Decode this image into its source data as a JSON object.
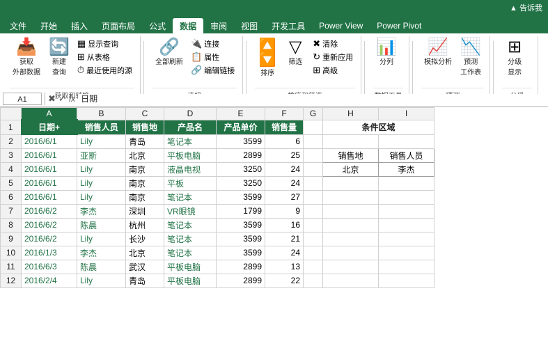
{
  "tabs": [
    "文件",
    "开始",
    "插入",
    "页面布局",
    "公式",
    "数据",
    "审阅",
    "视图",
    "开发工具",
    "Power View",
    "Power Pivot"
  ],
  "active_tab": "数据",
  "alert": "告诉我",
  "ribbon": {
    "groups": [
      {
        "label": "获取和转换",
        "buttons": [
          {
            "icon": "📥",
            "label": "获取\n外部数据"
          },
          {
            "icon": "🔄",
            "label": "新建\n查询"
          },
          {
            "small": [
              "显示查询",
              "从表格",
              "最近使用的源"
            ]
          }
        ]
      },
      {
        "label": "连接",
        "buttons": [
          {
            "icon": "🔗",
            "label": "全部刷新"
          },
          {
            "small": [
              "连接",
              "属性",
              "编辑链接"
            ]
          }
        ]
      },
      {
        "label": "排序和筛选",
        "buttons": [
          {
            "icon": "AZ↑",
            "label": "排序"
          },
          {
            "icon": "▽",
            "label": "筛选"
          },
          {
            "small": [
              "清除",
              "重新应用",
              "高级"
            ]
          }
        ]
      },
      {
        "label": "数据工具",
        "buttons": [
          {
            "icon": "📊",
            "label": "分列"
          }
        ]
      },
      {
        "label": "预测",
        "buttons": [
          {
            "icon": "📈",
            "label": "模拟分析"
          },
          {
            "icon": "📉",
            "label": "预测\n工作表"
          }
        ]
      },
      {
        "label": "分级",
        "buttons": [
          {
            "icon": "⊞",
            "label": "分级\n显示"
          }
        ]
      }
    ]
  },
  "formula_bar": {
    "cell_ref": "A1",
    "formula": "日期"
  },
  "columns": [
    "A",
    "B",
    "C",
    "D",
    "E",
    "F",
    "G",
    "H",
    "I"
  ],
  "col_headers": [
    "日期+",
    "销售人员",
    "销售地",
    "产品名",
    "产品单价",
    "销售量",
    "",
    "条件区域",
    ""
  ],
  "rows": [
    [
      "",
      "",
      "",
      "",
      "",
      "",
      "",
      "",
      ""
    ],
    [
      "2016/6/1",
      "Lily",
      "青岛",
      "笔记本",
      "3599",
      "6",
      "",
      "",
      ""
    ],
    [
      "2016/6/1",
      "亚斯",
      "北京",
      "平板电脑",
      "2899",
      "25",
      "",
      "",
      ""
    ],
    [
      "2016/6/1",
      "Lily",
      "南京",
      "液晶电视",
      "3250",
      "24",
      "",
      "",
      ""
    ],
    [
      "2016/6/1",
      "Lily",
      "南京",
      "平板",
      "3250",
      "24",
      "",
      "",
      ""
    ],
    [
      "2016/6/1",
      "Lily",
      "南京",
      "笔记本",
      "3599",
      "27",
      "",
      "",
      ""
    ],
    [
      "2016/6/2",
      "李杰",
      "深圳",
      "VR眼镜",
      "1799",
      "9",
      "",
      "",
      ""
    ],
    [
      "2016/6/2",
      "陈晨",
      "杭州",
      "笔记本",
      "3599",
      "16",
      "",
      "",
      ""
    ],
    [
      "2016/6/2",
      "Lily",
      "长沙",
      "笔记本",
      "3599",
      "21",
      "",
      "",
      ""
    ],
    [
      "2016/1/3",
      "李杰",
      "北京",
      "笔记本",
      "3599",
      "24",
      "",
      "",
      ""
    ],
    [
      "2016/6/3",
      "陈晨",
      "武汉",
      "平板电脑",
      "2899",
      "13",
      "",
      "",
      ""
    ],
    [
      "2016/2/4",
      "Lily",
      "青岛",
      "平板电脑",
      "2899",
      "22",
      "",
      "",
      ""
    ]
  ],
  "condition_area": {
    "title": "条件区域",
    "headers": [
      "销售地",
      "销售人员"
    ],
    "values": [
      "北京",
      "李杰"
    ]
  },
  "row_numbers": [
    "1",
    "2",
    "3",
    "4",
    "5",
    "6",
    "7",
    "8",
    "9",
    "10",
    "11",
    "12"
  ]
}
